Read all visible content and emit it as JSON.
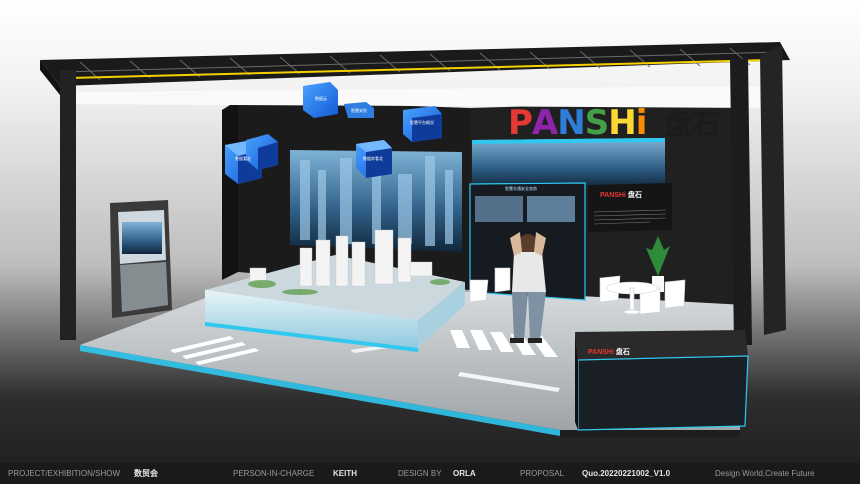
{
  "booth": {
    "brand_logo_letters": [
      "P",
      "A",
      "N",
      "S",
      "H",
      "i"
    ],
    "brand_logo_colors": [
      "#e53935",
      "#8e24aa",
      "#2e7dd7",
      "#43a047",
      "#fdd835",
      "#fb8c00"
    ],
    "brand_chinese": "盘石",
    "mini_logo_latin": "PANSHi",
    "mini_logo_chinese": "盘石",
    "cubes": [
      {
        "text": "数据看北"
      },
      {
        "text": "数据云"
      },
      {
        "text": "智慧安防"
      },
      {
        "text": "智慧平台概况"
      },
      {
        "text": "数据库看北"
      }
    ],
    "display_panel_title": "智慧交通安全态势",
    "accent_color": "#31c8f0",
    "wall_color": "#1c1c1c"
  },
  "footer": {
    "project_label": "PROJECT/EXHIBITION/SHOW",
    "project_value": "数贸会",
    "person_label": "PERSON-IN-CHARGE",
    "person_value": "KEITH",
    "design_label": "DESIGN BY",
    "design_value": "ORLA",
    "proposal_label": "PROPOSAL",
    "proposal_value": "Quo.20220221002_V1.0",
    "slogan": "Design World,Create Future"
  }
}
